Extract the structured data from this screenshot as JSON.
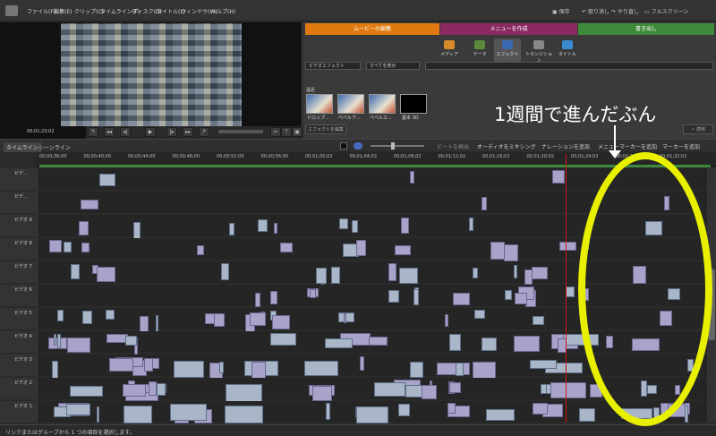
{
  "menu": {
    "items": [
      "ファイル(F)",
      "編集(E)",
      "クリップ(C)",
      "タイムライン(T)",
      "ディスク(D)",
      "タイトル(L)",
      "ウィンドウ(W)",
      "ヘルプ(H)"
    ],
    "save": "保存",
    "undo": "取り消し",
    "redo": "やり直し",
    "fullscreen": "フルスクリーン"
  },
  "preview": {
    "timecode": "00;01;23;02"
  },
  "right_panel": {
    "tabs": [
      "ムービーの編集",
      "メニューを作成",
      "書き出し"
    ],
    "tab_colors": [
      "#e07a10",
      "#8a2a60",
      "#3f8a3a"
    ],
    "tools": [
      "メディア",
      "テーマ",
      "エフェクト",
      "トランジション",
      "タイトル"
    ],
    "category_select": "ビデオエフェクト",
    "filter_select": "すべてを表示",
    "section_label": "遠近",
    "thumbs": [
      "ドロップ...",
      "ベベルア...",
      "ベベルエ...",
      "基本 3D"
    ],
    "edit_effect_button": "エフェクトを編集",
    "apply_button": "適用"
  },
  "timeline_header": {
    "tabs": [
      "タイムライン",
      "シーンライン"
    ],
    "detect_beats": "ビートを検出",
    "audio_mixing": "オーディオをミキシング",
    "add_narration": "ナレーションを追加",
    "add_menu_marker": "メニューマーカーを追加",
    "add_marker": "マーカーを追加"
  },
  "ruler_ticks": [
    "00;00;36;00",
    "00;00;40;00",
    "00;00;44;00",
    "00;00;48;00",
    "00;00;52;00",
    "00;00;56;00",
    "00;01;00;02",
    "00;01;04;02",
    "00;01;08;02",
    "00;01;12;02",
    "00;01;16;02",
    "00;01;20;02",
    "00;01;24;02",
    "00;01;28;02",
    "00;01;32;02"
  ],
  "tracks": [
    "ビデ...",
    "ビデ...",
    "ビデオ 9",
    "ビデオ 8",
    "ビデオ 7",
    "ビデオ 6",
    "ビデオ 5",
    "ビデオ 4",
    "ビデオ 3",
    "ビデオ 2",
    "ビデオ 1"
  ],
  "status": "リンクまたはグループから 1 つの項目を選択します。",
  "annotation": "1週間で進んだぶん",
  "annotation_color": "#e8f000"
}
